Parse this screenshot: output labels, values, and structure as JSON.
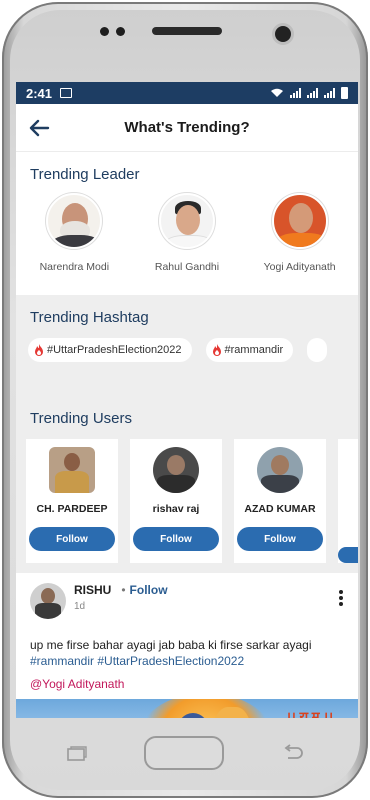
{
  "status": {
    "time": "2:41"
  },
  "appbar": {
    "title": "What's Trending?"
  },
  "leaders": {
    "title": "Trending Leader",
    "items": [
      {
        "name": "Narendra Modi"
      },
      {
        "name": "Rahul Gandhi"
      },
      {
        "name": "Yogi Adityanath"
      }
    ]
  },
  "hashtags": {
    "title": "Trending Hashtag",
    "items": [
      {
        "label": "#UttarPradeshElection2022"
      },
      {
        "label": "#rammandir"
      }
    ]
  },
  "users": {
    "title": "Trending Users",
    "follow_label": "Follow",
    "items": [
      {
        "name": "CH. PARDEEP"
      },
      {
        "name": "rishav raj"
      },
      {
        "name": "AZAD KUMAR"
      }
    ]
  },
  "post": {
    "author": "RISHU",
    "separator": "•",
    "follow_label": "Follow",
    "time": "1d",
    "text": "up me firse bahar ayagi jab baba ki firse sarkar ayagi",
    "hashtag_1": "#rammandir",
    "hashtag_2": "#UttarPradeshElection2022",
    "mention": "@Yogi Adityanath",
    "image_text": "।। रा म ।।"
  },
  "colors": {
    "statusbar": "#1d3d63",
    "section_title": "#1f3d60",
    "follow_button": "#2b6cb0",
    "mention": "#c2185b",
    "hashtag": "#2b5d91"
  }
}
